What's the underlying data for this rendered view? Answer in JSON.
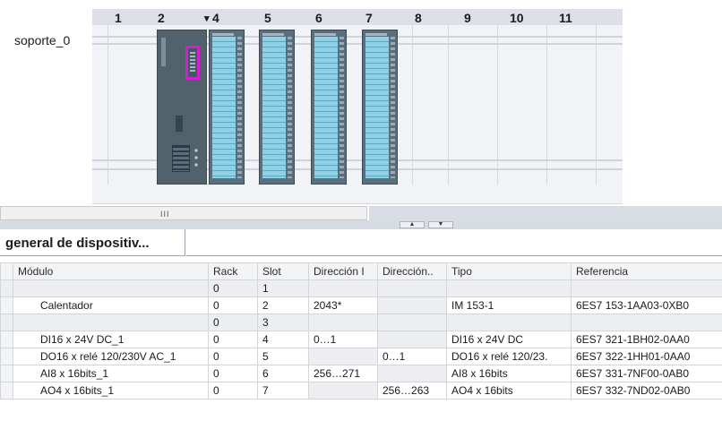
{
  "rack": {
    "name": "soporte_0",
    "slots": [
      "1",
      "2",
      "4",
      "5",
      "6",
      "7",
      "8",
      "9",
      "10",
      "11"
    ],
    "insert_marker": "▾"
  },
  "scrollbar": {
    "thumb_grip": "III"
  },
  "splitter": {
    "up": "▲",
    "down": "▼"
  },
  "overview": {
    "tab_label": "general de dispositiv...",
    "columns": [
      "Módulo",
      "Rack",
      "Slot",
      "Dirección I",
      "Dirección..",
      "Tipo",
      "Referencia"
    ],
    "rows": [
      {
        "module": "",
        "rack": "0",
        "slot": "1",
        "addr_i": "",
        "addr_q": "",
        "type": "",
        "ref": ""
      },
      {
        "module": "Calentador",
        "rack": "0",
        "slot": "2",
        "addr_i": "2043*",
        "addr_q": "",
        "type": "IM 153-1",
        "ref": "6ES7 153-1AA03-0XB0"
      },
      {
        "module": "",
        "rack": "0",
        "slot": "3",
        "addr_i": "",
        "addr_q": "",
        "type": "",
        "ref": ""
      },
      {
        "module": "DI16 x 24V DC_1",
        "rack": "0",
        "slot": "4",
        "addr_i": "0…1",
        "addr_q": "",
        "type": "DI16 x 24V DC",
        "ref": "6ES7 321-1BH02-0AA0"
      },
      {
        "module": "DO16 x relé 120/230V AC_1",
        "rack": "0",
        "slot": "5",
        "addr_i": "",
        "addr_q": "0…1",
        "type": "DO16 x relé 120/23.",
        "ref": "6ES7 322-1HH01-0AA0"
      },
      {
        "module": "AI8 x 16bits_1",
        "rack": "0",
        "slot": "6",
        "addr_i": "256…271",
        "addr_q": "",
        "type": "AI8 x 16bits",
        "ref": "6ES7 331-7NF00-0AB0"
      },
      {
        "module": "AO4 x 16bits_1",
        "rack": "0",
        "slot": "7",
        "addr_i": "",
        "addr_q": "256…263",
        "type": "AO4 x 16bits",
        "ref": "6ES7 332-7ND02-0AB0"
      }
    ]
  },
  "colors": {
    "module_body": "#5a6f7d",
    "io_strip": "#8fd0e6",
    "selected_connector": "#d21fd1",
    "slot_header": "#dde0e8"
  }
}
